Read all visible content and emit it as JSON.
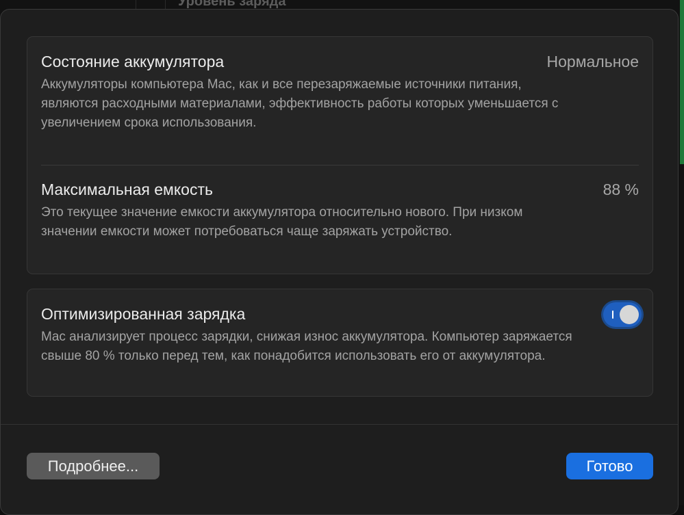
{
  "background": {
    "behind_title": "Уровень заряда"
  },
  "battery_health": {
    "title": "Состояние аккумулятора",
    "value": "Нормальное",
    "description": "Аккумуляторы компьютера Mac, как и все перезаряжаемые источники питания, являются расходными материалами, эффективность работы которых уменьшается с увеличением срока использования."
  },
  "max_capacity": {
    "title": "Максимальная емкость",
    "value": "88 %",
    "description": "Это текущее значение емкости аккумулятора относительно нового. При низком значении емкости может потребоваться чаще заряжать устройство."
  },
  "optimized_charging": {
    "title": "Оптимизированная зарядка",
    "enabled": true,
    "description": "Mac анализирует процесс зарядки, снижая износ аккумулятора. Компьютер заряжается свыше 80 % только перед тем, как понадобится использовать его от аккумулятора."
  },
  "footer": {
    "more_label": "Подробнее...",
    "done_label": "Готово"
  },
  "colors": {
    "accent": "#1a6fe0",
    "toggle_on": "#1f5fbf"
  }
}
